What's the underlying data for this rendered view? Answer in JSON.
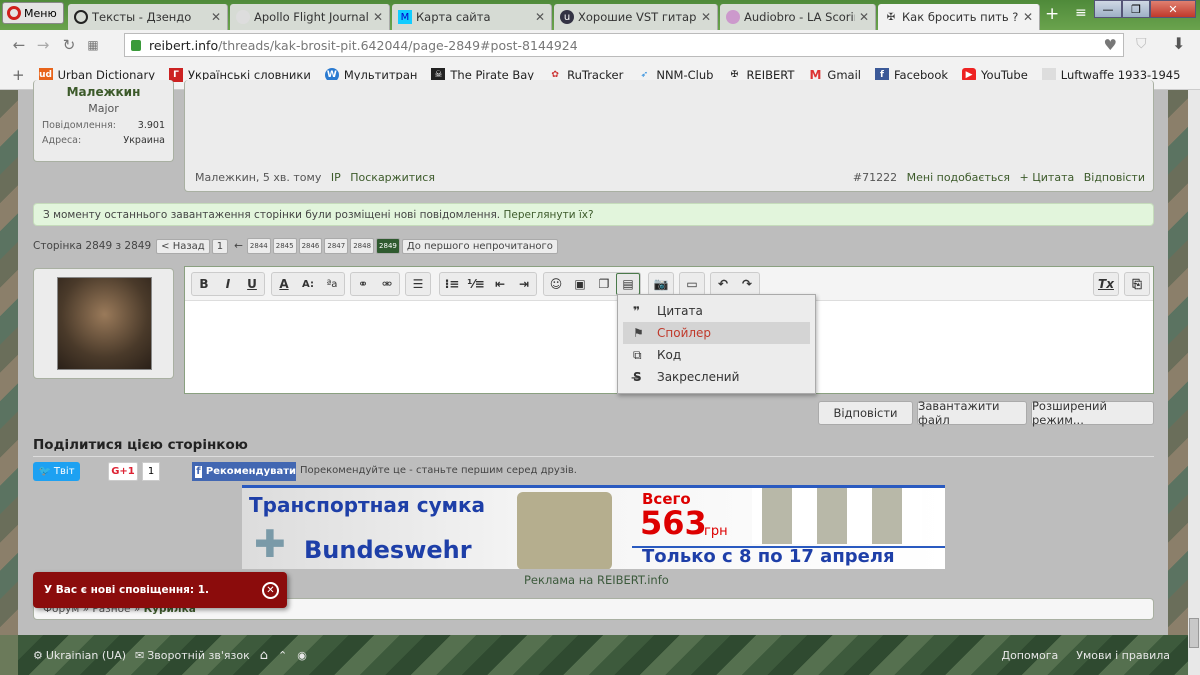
{
  "browser": {
    "menu_label": "Меню",
    "tabs": [
      {
        "title": "Тексты - Дзендо"
      },
      {
        "title": "Apollo Flight Journal -"
      },
      {
        "title": "Карта сайта"
      },
      {
        "title": "Хорошие VST гитары,"
      },
      {
        "title": "Audiobro - LA Scoring"
      },
      {
        "title": "Как бросить пить ?!| О"
      }
    ],
    "url_host": "reibert.info",
    "url_path": "/threads/kak-brosit-pit.642044/page-2849#post-8144924",
    "bookmarks": [
      "Urban Dictionary",
      "Українські словники",
      "Мультитран",
      "The Pirate Bay",
      "RuTracker",
      "NNM-Club",
      "REIBERT",
      "Gmail",
      "Facebook",
      "YouTube",
      "Luftwaffe 1933-1945"
    ]
  },
  "user": {
    "name": "Малежкин",
    "rank": "Major",
    "posts_label": "Повідомлення:",
    "posts": "3.901",
    "addr_label": "Адреса:",
    "addr": "Украина"
  },
  "post": {
    "author_time": "Малежкин, 5 хв. тому",
    "ip": "IP",
    "report": "Поскаржитися",
    "number": "#71222",
    "like": "Мені подобається",
    "quote": "+ Цитата",
    "reply": "Відповісти"
  },
  "notice": {
    "text": "З моменту останнього завантаження сторінки були розміщені нові повідомлення.",
    "link": "Переглянути їх?"
  },
  "pagination": {
    "label": "Сторінка 2849 з 2849",
    "prev": "< Назад",
    "first": "1",
    "ellipsis": "←",
    "pages": [
      "2844",
      "2845",
      "2846",
      "2847",
      "2848",
      "2849"
    ],
    "unread": "До першого непрочитаного"
  },
  "dropdown": {
    "items": [
      {
        "icon": "❞",
        "label": "Цитата"
      },
      {
        "icon": "⚑",
        "label": "Спойлер"
      },
      {
        "icon": "⧉",
        "label": "Код"
      },
      {
        "icon": "S̶",
        "label": "Закреслений"
      }
    ]
  },
  "actions": {
    "reply": "Відповісти",
    "upload": "Завантажити файл",
    "advanced": "Розширений режим..."
  },
  "share": {
    "title": "Поділитися цією сторінкою",
    "tweet": "Твіт",
    "gplus": "G+1",
    "gcount": "1",
    "fb": "Рекомендувати",
    "fb_text": "Порекомендуйте це - станьте першим серед друзів."
  },
  "ad": {
    "line1": "Транспортная сумка",
    "brand": "Bundeswehr",
    "price_pre": "Всего",
    "price": "563",
    "currency": "грн",
    "dates": "Только с 8 по 17 апреля",
    "caption": "Реклама на REIBERT.info"
  },
  "toast": {
    "text": "У Вас є нові сповіщення: 1."
  },
  "breadcrumb": [
    "Форум",
    "Разное",
    "Курилка"
  ],
  "footer": {
    "lang": "Ukrainian (UA)",
    "contact": "Зворотній зв'язок",
    "help": "Допомога",
    "terms": "Умови і правила"
  }
}
